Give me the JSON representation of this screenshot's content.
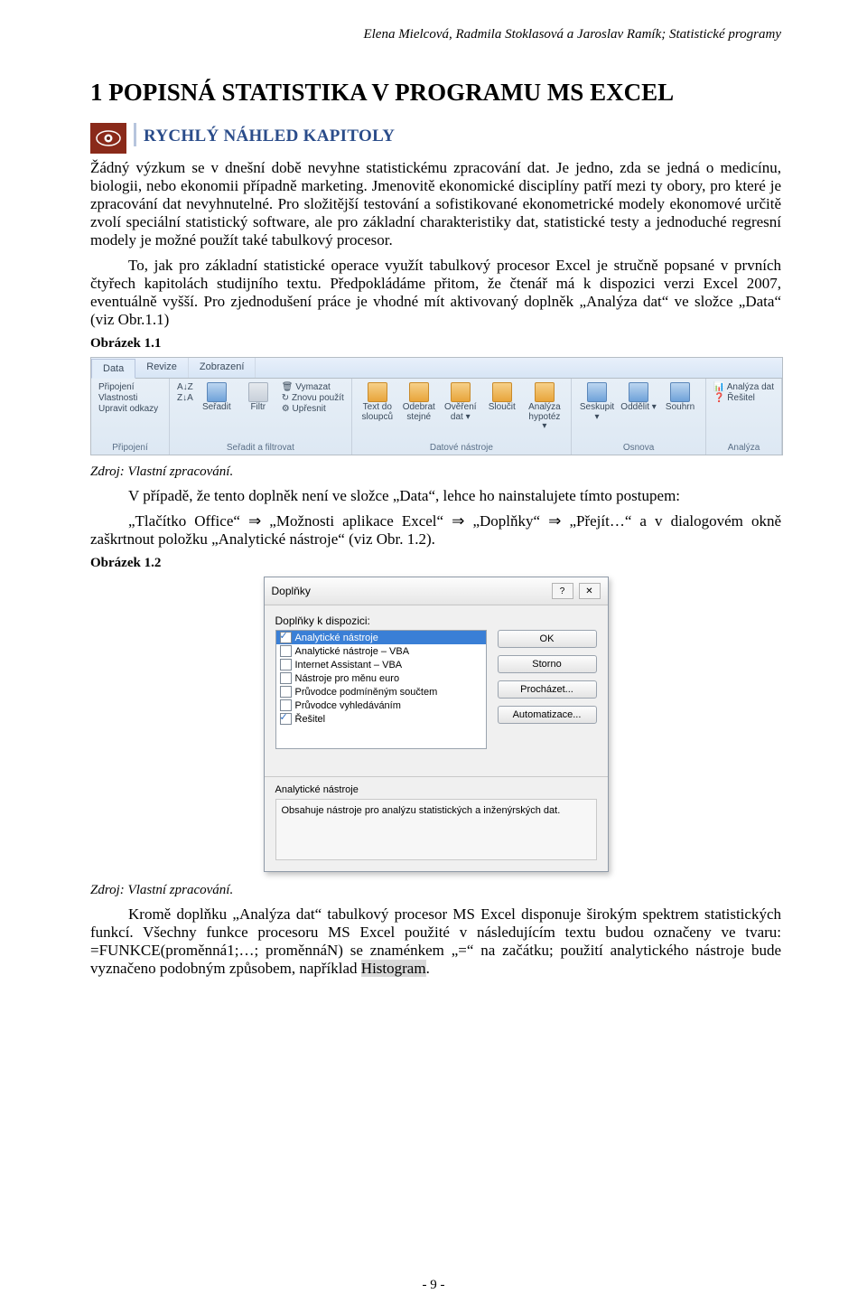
{
  "header": "Elena Mielcová, Radmila Stoklasová a Jaroslav Ramík; Statistické programy",
  "h1": "1  POPISNÁ STATISTIKA V PROGRAMU MS EXCEL",
  "subheading": "RYCHLÝ NÁHLED KAPITOLY",
  "lead": "Žádný výzkum se v dnešní době nevyhne statistickému zpracování dat. Je jedno, zda se jedná o medicínu, biologii, nebo ekonomii případně marketing. Jmenovitě ekonomické disciplíny patří mezi ty obory, pro které je zpracování dat nevyhnutelné. Pro složitější testování a sofistikované ekonometrické modely ekonomové určitě zvolí speciální statistický software, ale pro základní charakteristiky dat, statistické testy a jednoduché regresní modely je možné použít také tabulkový procesor.",
  "para2": "To, jak pro základní statistické operace využít tabulkový procesor Excel je stručně popsané v prvních čtyřech kapitolách studijního textu. Předpokládáme přitom, že čtenář má k dispozici verzi Excel 2007, eventuálně vyšší. Pro zjednodušení práce je vhodné mít aktivovaný doplněk „Analýza dat“ ve složce „Data“ (viz Obr.1.1)",
  "fig1": "Obrázek 1.1",
  "source": "Zdroj: Vlastní zpracování.",
  "para3a": "V případě, že tento doplněk není ve složce „Data“, lehce ho nainstalujete tímto postupem:",
  "para3b": "„Tlačítko Office“  ⇒  „Možnosti aplikace Excel“  ⇒  „Doplňky“  ⇒  „Přejít…“ a v dialogovém okně zaškrtnout položku „Analytické nástroje“ (viz Obr. 1.2).",
  "fig2": "Obrázek 1.2",
  "para4_pre": "Kromě doplňku „Analýza dat“ tabulkový procesor MS Excel disponuje širokým spektrem statistických funkcí. Všechny funkce procesoru MS Excel použité v následujícím textu budou označeny ve tvaru: =FUNKCE(proměnná1;…; proměnnáN) se znaménkem „=“ na začátku; použití analytického nástroje bude vyznačeno podobným způsobem, například ",
  "para4_hl": "Histogram",
  "para4_post": ".",
  "page_num": "- 9 -",
  "ribbon": {
    "tabs": [
      "Data",
      "Revize",
      "Zobrazení"
    ],
    "left": {
      "l1": "Připojení",
      "l2": "Vlastnosti",
      "l3": "Upravit odkazy",
      "group": "Připojení"
    },
    "sort": {
      "az": "A↓Z",
      "za": "Z↓A",
      "seradit": "Seřadit",
      "filtr": "Filtr",
      "vymazat": "Vymazat",
      "znovu": "Znovu použít",
      "upresnit": "Upřesnit",
      "group": "Seřadit a filtrovat"
    },
    "tools": {
      "text": "Text do sloupců",
      "odebrat": "Odebrat stejné",
      "overeni": "Ověření dat ▾",
      "sloucit": "Sloučit",
      "hypotez": "Analýza hypotéz ▾",
      "group": "Datové nástroje"
    },
    "outline": {
      "seskupit": "Seskupit ▾",
      "oddelit": "Oddělit ▾",
      "souhrn": "Souhrn",
      "group": "Osnova"
    },
    "analyza": {
      "analyza": "Analýza dat",
      "resitel": "Řešitel",
      "group": "Analýza"
    }
  },
  "dlg": {
    "title": "Doplňky",
    "label": "Doplňky k dispozici:",
    "options": [
      {
        "label": "Analytické nástroje",
        "checked": true,
        "selected": true
      },
      {
        "label": "Analytické nástroje – VBA",
        "checked": false
      },
      {
        "label": "Internet Assistant – VBA",
        "checked": false
      },
      {
        "label": "Nástroje pro měnu euro",
        "checked": false
      },
      {
        "label": "Průvodce podmíněným součtem",
        "checked": false
      },
      {
        "label": "Průvodce vyhledáváním",
        "checked": false
      },
      {
        "label": "Řešitel",
        "checked": true
      }
    ],
    "buttons": {
      "ok": "OK",
      "storno": "Storno",
      "prochazet": "Procházet...",
      "auto": "Automatizace..."
    },
    "subtitle": "Analytické nástroje",
    "desc": "Obsahuje nástroje pro analýzu statistických a inženýrských dat."
  }
}
